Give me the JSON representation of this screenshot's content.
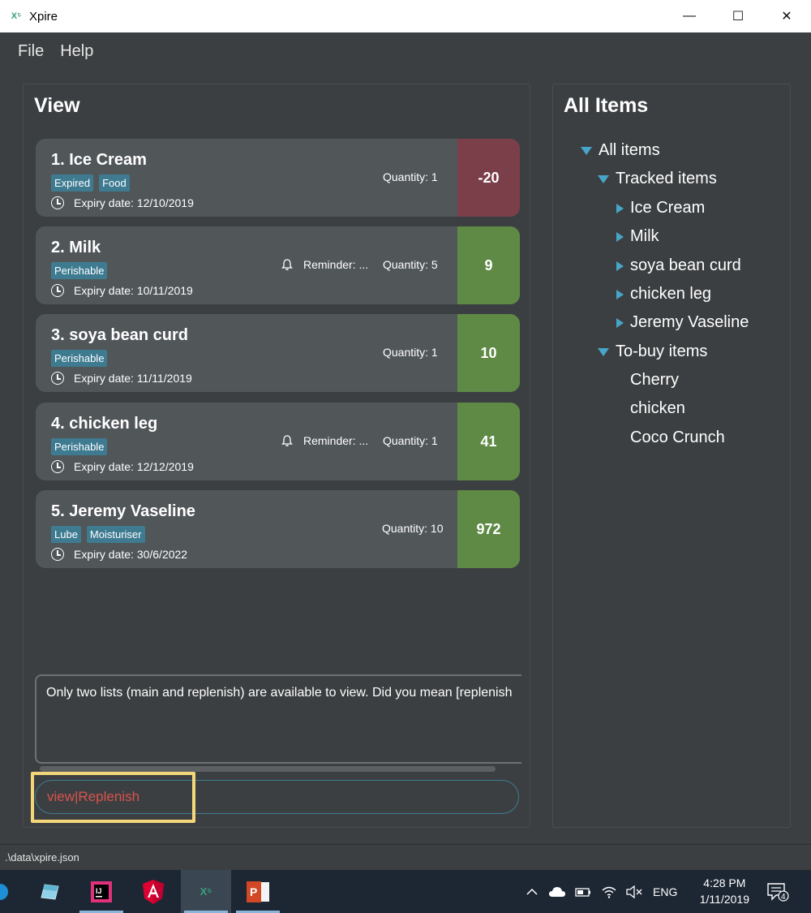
{
  "window": {
    "title": "Xpire",
    "minimize": "—",
    "maximize": "☐",
    "close": "✕"
  },
  "menu": {
    "file": "File",
    "help": "Help"
  },
  "view_panel": {
    "title": "View",
    "items": [
      {
        "name": "1.  Ice Cream",
        "tags": [
          "Expired",
          "Food"
        ],
        "expiry": "Expiry date: 12/10/2019",
        "reminder": "",
        "quantity": "Quantity: 1",
        "days": "-20",
        "status": "expired"
      },
      {
        "name": "2.  Milk",
        "tags": [
          "Perishable"
        ],
        "expiry": "Expiry date: 10/11/2019",
        "reminder": "Reminder: ...",
        "quantity": "Quantity: 5",
        "days": "9",
        "status": "ok"
      },
      {
        "name": "3.  soya bean curd",
        "tags": [
          "Perishable"
        ],
        "expiry": "Expiry date: 11/11/2019",
        "reminder": "",
        "quantity": "Quantity: 1",
        "days": "10",
        "status": "ok"
      },
      {
        "name": "4.  chicken leg",
        "tags": [
          "Perishable"
        ],
        "expiry": "Expiry date: 12/12/2019",
        "reminder": "Reminder: ...",
        "quantity": "Quantity: 1",
        "days": "41",
        "status": "ok"
      },
      {
        "name": "5.  Jeremy Vaseline",
        "tags": [
          "Lube",
          "Moisturiser"
        ],
        "expiry": "Expiry date: 30/6/2022",
        "reminder": "",
        "quantity": "Quantity: 10",
        "days": "972",
        "status": "ok"
      }
    ]
  },
  "result": {
    "text": "Only two lists (main and replenish) are available to view. Did you mean [replenish"
  },
  "command": {
    "value": "view|Replenish"
  },
  "all_items_panel": {
    "title": "All Items",
    "root": "All items",
    "tracked_label": "Tracked items",
    "tracked": [
      "Ice Cream",
      "Milk",
      "soya bean curd",
      "chicken leg",
      "Jeremy Vaseline"
    ],
    "tobuy_label": "To-buy items",
    "tobuy": [
      "Cherry",
      "chicken",
      "Coco Crunch"
    ]
  },
  "status_bar": {
    "path": ".\\data\\xpire.json"
  },
  "taskbar": {
    "time": "4:28 PM",
    "date": "1/11/2019",
    "language": "ENG",
    "notifications": "4",
    "apps": [
      "ie-icon",
      "intellij-icon",
      "angular-icon",
      "xpire-icon",
      "powerpoint-icon"
    ]
  },
  "colors": {
    "expired": "#7b3f4a",
    "ok": "#5e8a45",
    "tag": "#3e7b91",
    "command_text": "#d9534f",
    "highlight": "#f4d67a"
  }
}
